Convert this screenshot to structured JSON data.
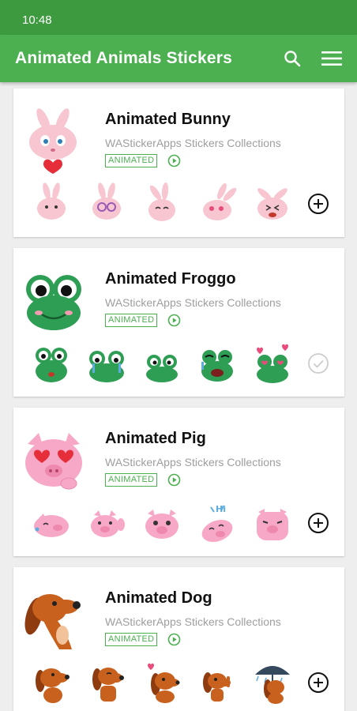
{
  "status_bar": {
    "time": "10:48"
  },
  "app_bar": {
    "title": "Animated Animals Stickers",
    "search_icon": "search-icon",
    "menu_icon": "hamburger-menu-icon"
  },
  "packs": [
    {
      "title": "Animated Bunny",
      "publisher": "WAStickerApps Stickers Collections",
      "badge": "ANIMATED",
      "action": "add",
      "color": "#f7c6d0",
      "sticker_count_shown": 5
    },
    {
      "title": "Animated Froggo",
      "publisher": "WAStickerApps Stickers Collections",
      "badge": "ANIMATED",
      "action": "added",
      "color": "#2e9e55",
      "sticker_count_shown": 5
    },
    {
      "title": "Animated Pig",
      "publisher": "WAStickerApps Stickers Collections",
      "badge": "ANIMATED",
      "action": "add",
      "color": "#f7a8c6",
      "sticker_count_shown": 5
    },
    {
      "title": "Animated Dog",
      "publisher": "WAStickerApps Stickers Collections",
      "badge": "ANIMATED",
      "action": "add",
      "color": "#c8611e",
      "sticker_count_shown": 5
    }
  ],
  "colors": {
    "status_bar": "#3d9a3f",
    "app_bar": "#4caf50",
    "accent": "#4caf50"
  }
}
